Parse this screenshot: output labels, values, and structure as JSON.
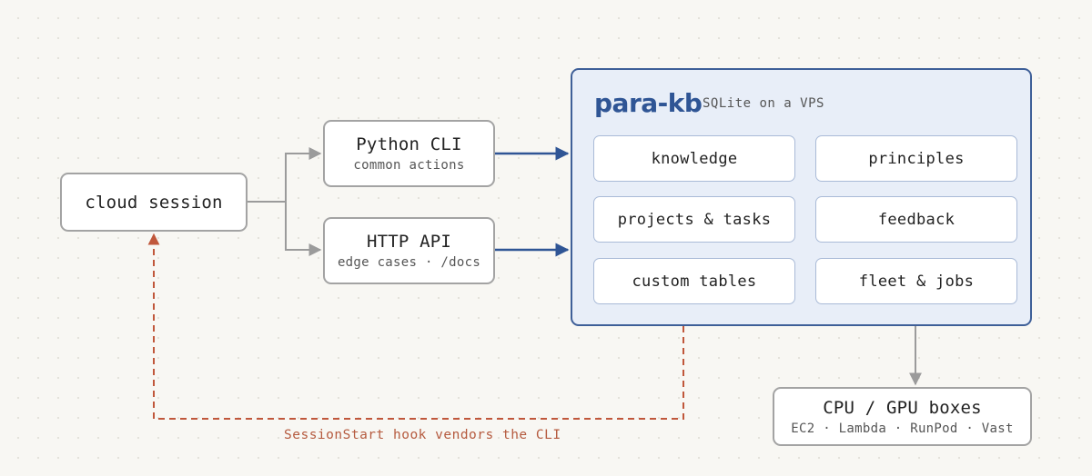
{
  "nodes": {
    "cloud_session": {
      "label": "cloud session"
    },
    "python_cli": {
      "title": "Python CLI",
      "subtitle": "common actions"
    },
    "http_api": {
      "title": "HTTP API",
      "subtitle": "edge cases · /docs"
    },
    "compute": {
      "title": "CPU / GPU boxes",
      "subtitle": "EC2 · Lambda · RunPod · Vast"
    }
  },
  "store": {
    "title": "para-kb",
    "subtitle": "SQLite on a VPS",
    "tables": [
      "knowledge",
      "principles",
      "projects & tasks",
      "feedback",
      "custom tables",
      "fleet & jobs"
    ]
  },
  "edges": {
    "hook_label": "SessionStart hook vendors the CLI"
  },
  "colors": {
    "accent": "#2f5595",
    "panel_fill": "#e8eef8",
    "connector_gray": "#9b9b9b",
    "hook_red": "#b55a3e"
  }
}
